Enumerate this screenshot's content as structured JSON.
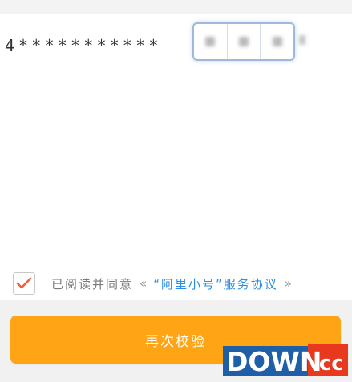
{
  "phone": {
    "first_digit": "4",
    "stars": "***********"
  },
  "agreement": {
    "prefix": "已阅读并同意",
    "open_quote": "«",
    "link": "“阿里小号”服务协议",
    "close_quote": "»",
    "checked": true
  },
  "button": {
    "label": "再次校验"
  },
  "watermark": {
    "text": "DOWN.cc"
  },
  "colors": {
    "accent": "#ffa414",
    "link": "#2a8fe4",
    "check": "#f06038",
    "code_border": "#9fb9dd"
  },
  "icons": {
    "checkbox": "checkmark-icon"
  }
}
